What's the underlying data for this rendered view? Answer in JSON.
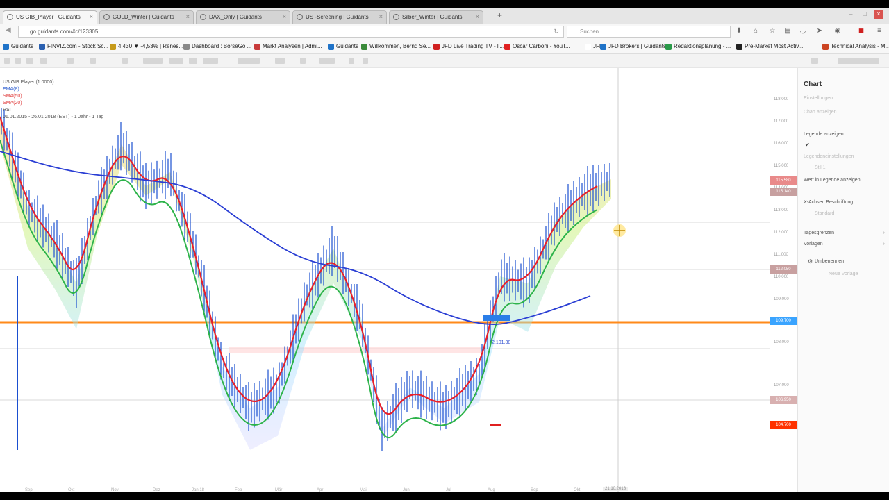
{
  "browser": {
    "tabs": [
      {
        "label": "US GIB_Player | Guidants",
        "active": true
      },
      {
        "label": "GOLD_Winter | Guidants",
        "active": false
      },
      {
        "label": "DAX_Only | Guidants",
        "active": false
      },
      {
        "label": "US -Screening | Guidants",
        "active": false
      },
      {
        "label": "Silber_Winter | Guidants",
        "active": false
      }
    ],
    "new_tab": "+",
    "close_glyph": "×",
    "url": "go.guidants.com/#c/123305",
    "search_placeholder": "Suchen",
    "bookmarks": [
      {
        "label": "Guidants",
        "color": "#1f73c8"
      },
      {
        "label": "FINVIZ.com - Stock Sc...",
        "color": "#2a60b0"
      },
      {
        "label": "4,430 ▼ -4,53% | Renes...",
        "color": "#c69a1a"
      },
      {
        "label": "Dashboard : BörseGo ...",
        "color": "#888888"
      },
      {
        "label": "Markt Analysen | Admi...",
        "color": "#c83a3a"
      },
      {
        "label": "Guidants",
        "color": "#1f73c8"
      },
      {
        "label": "Willkommen, Bernd Se...",
        "color": "#3a8a3a"
      },
      {
        "label": "JFD Live Trading TV - li...",
        "color": "#d02020"
      },
      {
        "label": "Oscar Carboni - YouT...",
        "color": "#e02020"
      },
      {
        "label": "JFD",
        "color": "#ffffff"
      },
      {
        "label": "JFD Brokers | Guidants",
        "color": "#1f73c8"
      },
      {
        "label": "Redaktionsplanung - ...",
        "color": "#2a9a4a"
      },
      {
        "label": "Pre-Market Most Activ...",
        "color": "#222222"
      },
      {
        "label": "Technical Analysis - M...",
        "color": "#cc4422"
      }
    ]
  },
  "chart": {
    "legend": [
      "US GIB Player (1.0000)",
      "EMA(8)",
      "SMA(50)",
      "SMA(20)",
      "RSI"
    ],
    "legend_range": "01.01.2015 - 26.01.2018 (EST) - 1 Jahr - 1 Tag",
    "x_ticks": [
      "Sep",
      "Okt",
      "Nov",
      "Dez",
      "Jan 18",
      "Feb",
      "Mär",
      "Apr",
      "Mai",
      "Jun",
      "Jul",
      "Aug",
      "Sep",
      "Okt"
    ],
    "x_time": "21.10.2018",
    "y_ticks": [
      "118.000",
      "117.000",
      "116.000",
      "115.000",
      "114.000",
      "113.000",
      "112.000",
      "111.000",
      "110.000",
      "109.000",
      "108.000",
      "107.000",
      "106.000"
    ],
    "price_tags": [
      {
        "label": "115.580",
        "color": "#e98a8a"
      },
      {
        "label": "115.140",
        "color": "#c7a0a0"
      },
      {
        "label": "112.050",
        "color": "#c8a0a0"
      },
      {
        "label": "109.700",
        "color": "#3aa4ff"
      },
      {
        "label": "106.950",
        "color": "#d8b0b0"
      },
      {
        "label": "104.700",
        "color": "#ff3300"
      }
    ],
    "annotation": "2.101,38",
    "colors": {
      "ema_red": "#e8202a",
      "sma_blue": "#2a3ed4",
      "sma_green": "#2db34a",
      "candles": "#1a4fd0",
      "support": "#ff8a1a"
    }
  },
  "sidebar": {
    "title": "Chart",
    "items": [
      {
        "label": "Einstellungen",
        "faint": true
      },
      {
        "label": "Chart anzeigen",
        "faint": true
      },
      {
        "label": "Legende anzeigen",
        "faint": false
      },
      {
        "label": "Legendeneinstellungen",
        "faint": true
      },
      {
        "label": "Stil 1",
        "faint": true
      },
      {
        "label": "Wert in Legende anzeigen",
        "faint": false
      },
      {
        "label": "X-Achsen Beschriftung",
        "faint": false
      },
      {
        "label": "Standard",
        "faint": true
      },
      {
        "label": "Tagesgrenzen",
        "faint": false
      },
      {
        "label": "Vorlagen",
        "faint": false
      },
      {
        "label": "Umbenennen",
        "faint": false
      },
      {
        "label": "Neue Vorlage",
        "faint": true
      }
    ],
    "checkmark": "✔",
    "arrow": "›",
    "gear": "⚙"
  }
}
